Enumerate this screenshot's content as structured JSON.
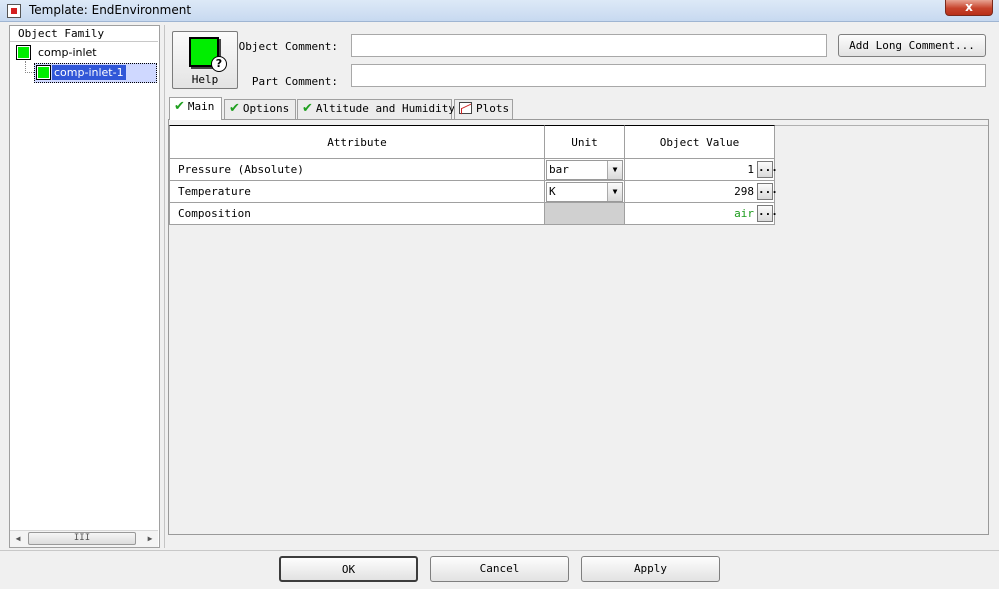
{
  "window": {
    "title": "Template: EndEnvironment",
    "close_glyph": "x"
  },
  "tree": {
    "header": "Object Family",
    "root": {
      "label": "comp-inlet",
      "icon": "green-component-icon"
    },
    "child": {
      "label": "comp-inlet-1",
      "icon": "green-component-icon",
      "selected": true
    },
    "hscroll_grip": "III"
  },
  "help": {
    "label": "Help",
    "badge": "?"
  },
  "comments": {
    "object_label": "Object Comment:",
    "object_value": "",
    "part_label": "Part Comment:",
    "part_value": "",
    "long_comment_button": "Add Long Comment..."
  },
  "tabs": [
    {
      "label": "Main",
      "icon": "check-icon",
      "active": true
    },
    {
      "label": "Options",
      "icon": "check-icon",
      "active": false
    },
    {
      "label": "Altitude and Humidity",
      "icon": "check-icon",
      "active": false
    },
    {
      "label": "Plots",
      "icon": "plot-icon",
      "active": false
    }
  ],
  "table": {
    "headers": {
      "attribute": "Attribute",
      "unit": "Unit",
      "value": "Object Value"
    },
    "rows": [
      {
        "attribute": "Pressure (Absolute)",
        "unit": "bar",
        "value": "1",
        "ellipsis": "..."
      },
      {
        "attribute": "Temperature",
        "unit": "K",
        "value": "298",
        "ellipsis": "..."
      },
      {
        "attribute": "Composition",
        "unit": "",
        "value": "air",
        "ellipsis": "..."
      }
    ]
  },
  "buttons": {
    "ok": "OK",
    "cancel": "Cancel",
    "apply": "Apply"
  },
  "colors": {
    "component_green": "#00ee00",
    "selection_blue": "#3157d8",
    "composition_value": "#1a9a1a"
  }
}
